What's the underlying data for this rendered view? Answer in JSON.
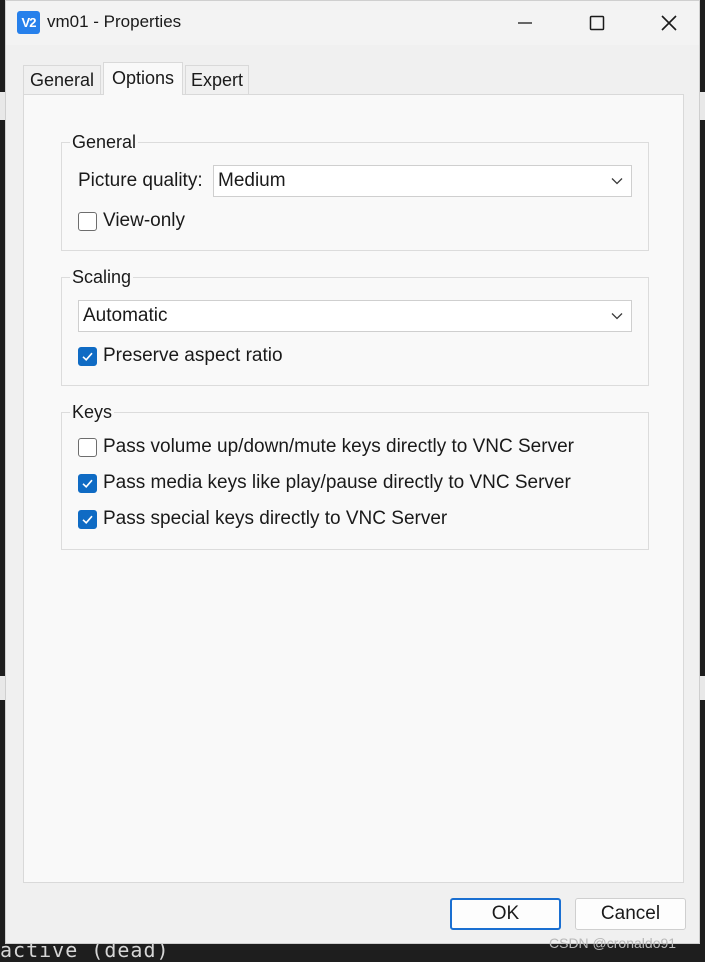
{
  "background": {
    "terminal_text": "active (dead)",
    "watermark": "CSDN @cronaldo91"
  },
  "window": {
    "title": "vm01 - Properties",
    "app_icon_text": "V2",
    "controls": {
      "minimize": "minimize-icon",
      "maximize": "maximize-icon",
      "close": "close-icon"
    }
  },
  "tabs": [
    {
      "label": "General",
      "active": false
    },
    {
      "label": "Options",
      "active": true
    },
    {
      "label": "Expert",
      "active": false
    }
  ],
  "groups": {
    "general": {
      "title": "General",
      "picture_quality_label": "Picture quality:",
      "picture_quality_value": "Medium",
      "view_only_label": "View-only",
      "view_only_checked": false
    },
    "scaling": {
      "title": "Scaling",
      "scaling_value": "Automatic",
      "preserve_label": "Preserve aspect ratio",
      "preserve_checked": true
    },
    "keys": {
      "title": "Keys",
      "items": [
        {
          "label": "Pass volume up/down/mute keys directly to VNC Server",
          "checked": false
        },
        {
          "label": "Pass media keys like play/pause directly to VNC Server",
          "checked": true
        },
        {
          "label": "Pass special keys directly to VNC Server",
          "checked": true
        }
      ]
    }
  },
  "buttons": {
    "ok": "OK",
    "cancel": "Cancel"
  },
  "colors": {
    "accent": "#0f6bc4",
    "ok_border": "#1a6fd1"
  }
}
